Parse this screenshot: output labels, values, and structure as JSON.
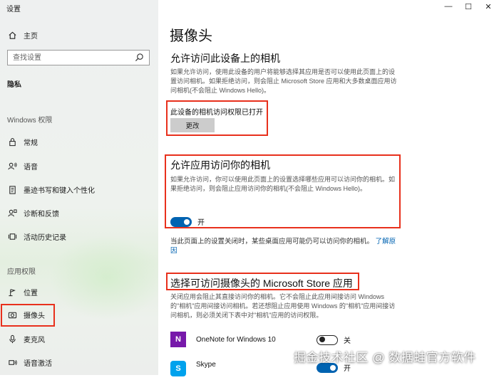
{
  "window": {
    "title": "设置",
    "controls": {
      "minimize": "—",
      "maximize": "☐",
      "close": "✕"
    }
  },
  "sidebar": {
    "home": {
      "label": "主页",
      "icon": "home-icon"
    },
    "search": {
      "placeholder": "查找设置",
      "icon": "search-icon"
    },
    "section": "隐私",
    "windows_permissions": {
      "heading": "Windows 权限",
      "items": [
        {
          "label": "常规",
          "icon": "lock-icon"
        },
        {
          "label": "语音",
          "icon": "speech-icon"
        },
        {
          "label": "墨迹书写和键入个性化",
          "icon": "clipboard-icon"
        },
        {
          "label": "诊断和反馈",
          "icon": "diagnostics-icon"
        },
        {
          "label": "活动历史记录",
          "icon": "activity-history-icon"
        }
      ]
    },
    "app_permissions": {
      "heading": "应用权限",
      "items": [
        {
          "label": "位置",
          "icon": "location-icon"
        },
        {
          "label": "摄像头",
          "icon": "camera-icon",
          "selected": true
        },
        {
          "label": "麦克风",
          "icon": "microphone-icon"
        },
        {
          "label": "语音激活",
          "icon": "voice-activation-icon"
        }
      ]
    }
  },
  "main": {
    "title": "摄像头",
    "device_access": {
      "heading": "允许访问此设备上的相机",
      "description": "如果允许访问，使用此设备的用户将能够选择其应用是否可以使用此页面上的设置访问相机。如果拒绝访问，则会阻止 Microsoft Store 应用和大多数桌面应用访问相机(不会阻止 Windows Hello)。",
      "status": "此设备的相机访问权限已打开",
      "change_button": "更改"
    },
    "app_access": {
      "heading": "允许应用访问你的相机",
      "description": "如果允许访问，你可以使用此页面上的设置选择哪些应用可以访问你的相机。如果拒绝访问，则会阻止应用访问你的相机(不会阻止 Windows Hello)。",
      "toggle_on": true,
      "toggle_label": "开"
    },
    "note": {
      "text": "当此页面上的设置关闭时，某些桌面应用可能仍可以访问你的相机。",
      "link": "了解原因"
    },
    "store_apps": {
      "heading": "选择可访问摄像头的 Microsoft Store 应用",
      "description": "关闭应用会阻止其直接访问你的相机。它不会阻止此应用间接访问 Windows 的\"相机\"应用间接访问相机。若还想阻止应用使用 Windows 的\"相机\"应用间接访问相机，则必须关闭下表中对\"相机\"应用的访问权限。",
      "apps": [
        {
          "name": "OneNote for Windows 10",
          "icon": "onenote-icon",
          "icon_text": "N",
          "color": "#7719aa",
          "on": false,
          "state_label": "关"
        },
        {
          "name": "Skype",
          "icon": "skype-icon",
          "icon_text": "S",
          "color": "#00a2ed",
          "on": true,
          "state_label": "开"
        }
      ]
    }
  },
  "watermark": "掘金技术社区 @ 数据蛙官方软件",
  "colors": {
    "accent": "#0063b1",
    "highlight": "#e8301c"
  }
}
